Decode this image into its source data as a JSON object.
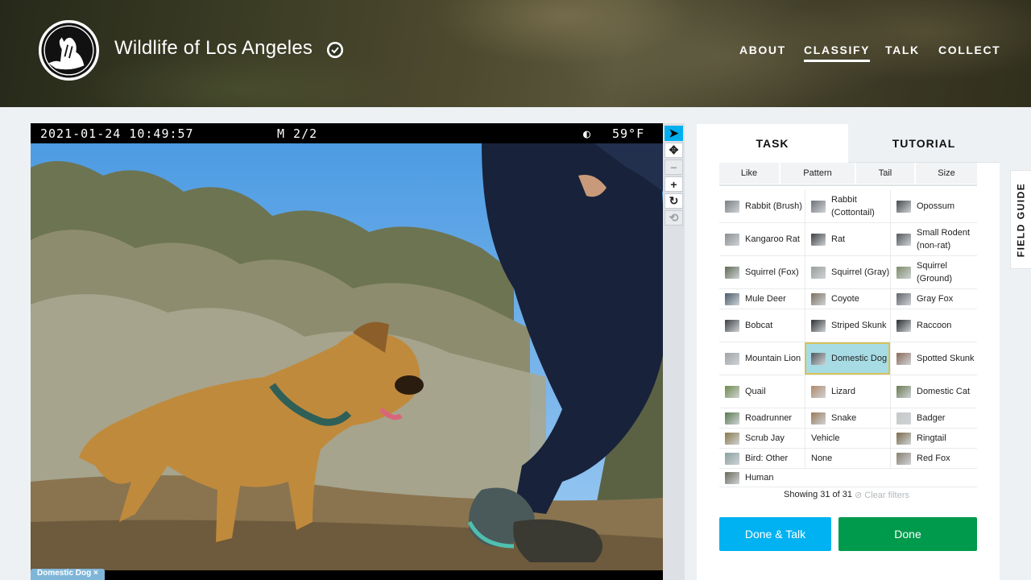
{
  "header": {
    "site_title": "Wildlife of Los Angeles",
    "nav": [
      "ABOUT",
      "CLASSIFY",
      "TALK",
      "COLLECT"
    ],
    "active_nav": "CLASSIFY"
  },
  "viewer": {
    "timestamp": "2021-01-24 10:49:57",
    "mode": "M 2/2",
    "moon": "◐",
    "temperature": "59°F",
    "selection_tag": "Domestic Dog ×",
    "tools": [
      {
        "name": "pointer-icon",
        "glyph": "➤"
      },
      {
        "name": "move-icon",
        "glyph": "✥"
      },
      {
        "name": "zoom-out-icon",
        "glyph": "−"
      },
      {
        "name": "zoom-in-icon",
        "glyph": "+"
      },
      {
        "name": "rotate-icon",
        "glyph": "↻"
      },
      {
        "name": "reset-icon",
        "glyph": "⟲"
      }
    ]
  },
  "task": {
    "tab_task": "TASK",
    "tab_tutorial": "TUTORIAL",
    "filters": [
      "Like",
      "Pattern",
      "Tail",
      "Size"
    ],
    "choices": [
      [
        {
          "label": "Rabbit (Brush)",
          "color": "#7a7f84"
        },
        {
          "label": "Rabbit (Cottontail)",
          "color": "#6f7378"
        },
        {
          "label": "Opossum",
          "color": "#45494d"
        }
      ],
      [
        {
          "label": "Kangaroo Rat",
          "color": "#8b8f93"
        },
        {
          "label": "Rat",
          "color": "#3d3f41"
        },
        {
          "label": "Small Rodent (non-rat)",
          "color": "#55585b"
        }
      ],
      [
        {
          "label": "Squirrel (Fox)",
          "color": "#5f6a55"
        },
        {
          "label": "Squirrel (Gray)",
          "color": "#9aa09a"
        },
        {
          "label": "Squirrel (Ground)",
          "color": "#7d8a6a"
        }
      ],
      [
        {
          "label": "Mule Deer",
          "color": "#4a5a6a"
        },
        {
          "label": "Coyote",
          "color": "#7a7060"
        },
        {
          "label": "Gray Fox",
          "color": "#606468"
        }
      ],
      [
        {
          "label": "Bobcat",
          "color": "#3c4044"
        },
        {
          "label": "Striped Skunk",
          "color": "#2e3032"
        },
        {
          "label": "Raccoon",
          "color": "#2a2c2e"
        }
      ],
      [
        {
          "label": "Mountain Lion",
          "color": "#a0a4a6"
        },
        {
          "label": "Domestic Dog",
          "color": "#50585c"
        },
        {
          "label": "Spotted Skunk",
          "color": "#8a6a5a"
        }
      ],
      [
        {
          "label": "Quail",
          "color": "#6f8a4a"
        },
        {
          "label": "Lizard",
          "color": "#b08a6a"
        },
        {
          "label": "Domestic Cat",
          "color": "#6a7a50"
        }
      ],
      [
        {
          "label": "Roadrunner",
          "color": "#5a7a50"
        },
        {
          "label": "Snake",
          "color": "#9a7a5a"
        },
        {
          "label": "Badger",
          "color": "#c8c8c8"
        }
      ],
      [
        {
          "label": "Scrub Jay",
          "color": "#8a7a4a"
        },
        {
          "label": "Vehicle",
          "color": ""
        },
        {
          "label": "Ringtail",
          "color": "#7a6a4a"
        }
      ],
      [
        {
          "label": "Bird: Other",
          "color": "#8aa0a0"
        },
        {
          "label": "None",
          "color": ""
        },
        {
          "label": "Red Fox",
          "color": "#8a8070"
        }
      ],
      [
        {
          "label": "Human",
          "color": "#6a6a5a"
        }
      ]
    ],
    "selected": "Domestic Dog",
    "showing": "Showing 31 of 31",
    "clear_filters": "⊘ Clear filters",
    "btn_done_talk": "Done & Talk",
    "btn_done": "Done",
    "field_guide": "FIELD GUIDE"
  }
}
